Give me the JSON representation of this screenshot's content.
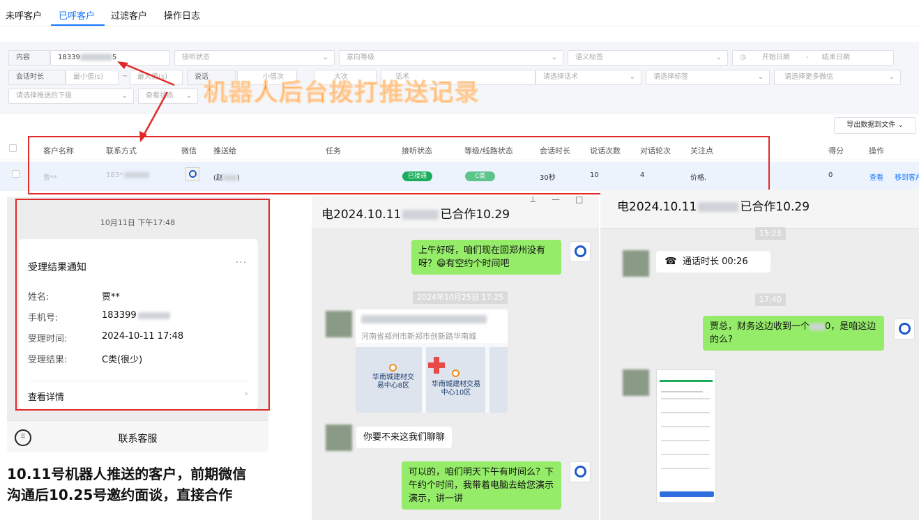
{
  "tabs": [
    "未呼客户",
    "已呼客户",
    "过滤客户",
    "操作日志"
  ],
  "filters": {
    "content_label": "内容",
    "content_value": "18339",
    "content_suffix": "5",
    "answer_status": "接听状态",
    "intent_level": "意向等级",
    "semantic_tag": "语义标签",
    "start_date": "开始日期",
    "date_sep": "-",
    "end_date": "结束日期",
    "duration_label": "会话时长",
    "min_value": "最小值(s)",
    "tilde": "~",
    "max_value": "最大值(s)",
    "truncated_1": "说话",
    "truncated_2": "小值次",
    "truncated_3": "大次",
    "truncated_4": "话术",
    "select_script": "请选择话术",
    "select_tag": "请选择标签",
    "select_more_wechat": "请选择更多微信",
    "select_push_sub": "请选择推送的下级",
    "view_status": "查看状态"
  },
  "big_title": "机器人后台拨打推送记录",
  "export_button": "导出数据到文件",
  "table": {
    "headers": [
      "客户名称",
      "联系方式",
      "微信",
      "推送给",
      "任务",
      "接听状态",
      "等级/线路状态",
      "会话时长",
      "说话次数",
      "对话轮次",
      "关注点",
      "得分",
      "操作"
    ],
    "row": {
      "name": "贾**",
      "phone": "183*",
      "push_to": "(赵",
      "push_to_suffix": ")",
      "answer_status": "已接通",
      "level": "C类",
      "duration": "30秒",
      "speak_count": "10",
      "rounds": "4",
      "focus": "价格.",
      "score": "0",
      "action_view": "查看",
      "action_move": "移到客户"
    }
  },
  "phone": {
    "time": "10月11日 下午17:48",
    "card_title": "受理结果通知",
    "name_label": "姓名:",
    "name_value": "贾**",
    "phone_label": "手机号:",
    "phone_value": "183399",
    "time_label": "受理时间:",
    "time_value": "2024-10-11 17:48",
    "result_label": "受理结果:",
    "result_value": "C类(很少)",
    "detail": "查看详情",
    "contact": "联系客服"
  },
  "caption_line1": "10.11号机器人推送的客户，前期微信",
  "caption_line2": "沟通后10.25号邀约面谈，直接合作",
  "chat1": {
    "title_a": "电2024.10.11",
    "title_b": "已合作10.29",
    "msg1": "上午好呀，咱们现在回郑州没有呀？😁有空约个时间吧",
    "timestamp": "2024年10月25日 17:25",
    "location_addr": "河南省郑州市新郑市创新路华南城",
    "map_label_1": "华南城建材交易中心8区",
    "map_label_2": "华南城建材交易中心10区",
    "msg2": "你要不来这我们聊聊",
    "msg3": "可以的，咱们明天下午有时间么？下午约个时间，我带着电脑去给您演示演示，讲一讲"
  },
  "chat2": {
    "title_a": "电2024.10.11",
    "title_b": "已合作10.29",
    "ts1": "15:23",
    "call": "通话时长 00:26",
    "ts2": "17:40",
    "msg1": "贾总，财务这边收到一个",
    "msg1_tail": "0，是咱这边的么?"
  },
  "colors": {
    "accent": "#1677ff",
    "orange_title": "#ff8a1c",
    "wechat_green": "#95ec69",
    "annotation_red": "#e02a2a",
    "pill_green": "#1aad5d",
    "pill_c": "#5dc48c"
  }
}
